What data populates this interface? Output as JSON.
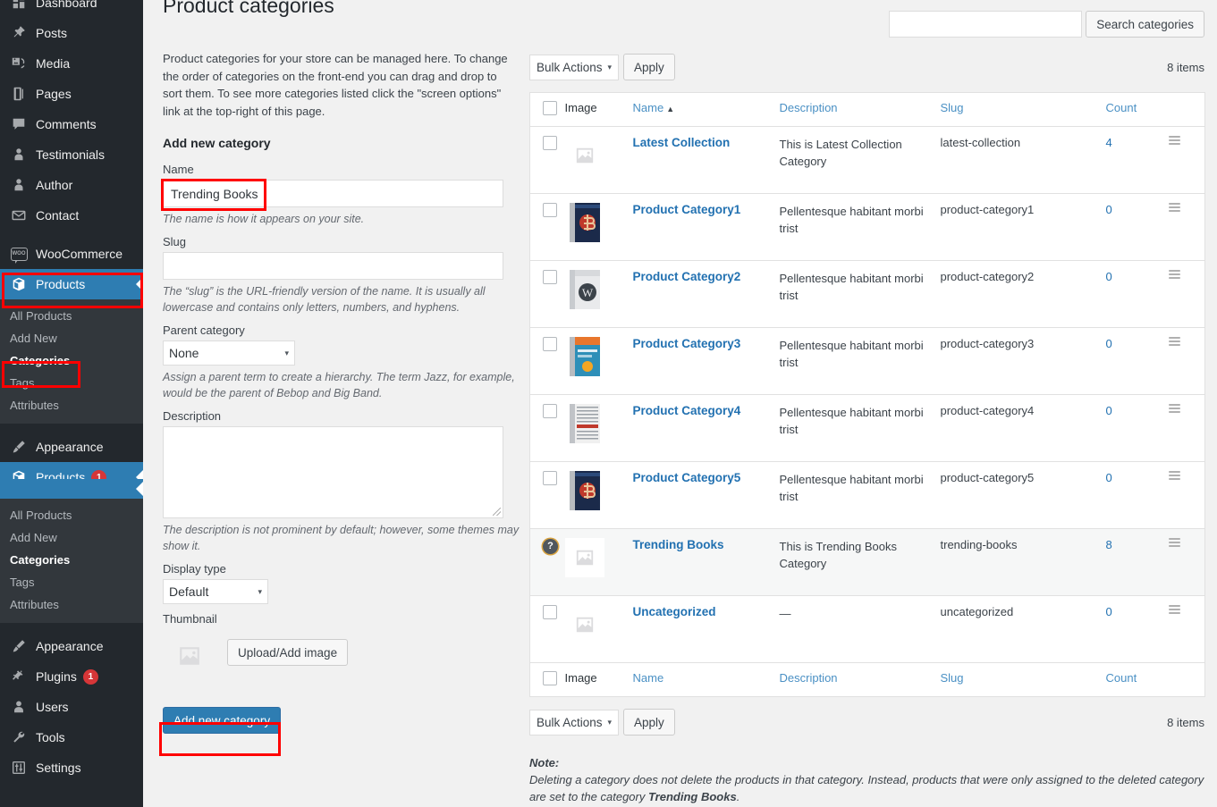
{
  "sidebar": {
    "top_items": [
      {
        "label": "Dashboard",
        "icon": "dashboard-icon"
      },
      {
        "label": "Posts",
        "icon": "pin-icon"
      },
      {
        "label": "Media",
        "icon": "media-icon"
      },
      {
        "label": "Pages",
        "icon": "pages-icon"
      },
      {
        "label": "Comments",
        "icon": "comment-icon"
      },
      {
        "label": "Testimonials",
        "icon": "person-icon"
      },
      {
        "label": "Author",
        "icon": "person-icon"
      },
      {
        "label": "Contact",
        "icon": "envelope-icon"
      }
    ],
    "woocommerce": {
      "label": "WooCommerce",
      "icon": "woo-icon",
      "mark": "WOO"
    },
    "products": {
      "label": "Products",
      "icon": "box-icon"
    },
    "products_submenu": [
      {
        "label": "All Products",
        "current": false
      },
      {
        "label": "Add New",
        "current": false
      },
      {
        "label": "Categories",
        "current": true
      },
      {
        "label": "Tags",
        "current": false
      },
      {
        "label": "Attributes",
        "current": false
      }
    ],
    "appearance": {
      "label": "Appearance",
      "icon": "brush-icon"
    },
    "bottom_items": [
      {
        "label": "Appearance",
        "icon": "brush-icon",
        "badge": ""
      },
      {
        "label": "Plugins",
        "icon": "plug-icon",
        "badge": "1"
      },
      {
        "label": "Users",
        "icon": "user-icon",
        "badge": ""
      },
      {
        "label": "Tools",
        "icon": "wrench-icon",
        "badge": ""
      },
      {
        "label": "Settings",
        "icon": "sliders-icon",
        "badge": ""
      }
    ]
  },
  "page": {
    "title": "Product categories",
    "intro": "Product categories for your store can be managed here. To change the order of categories on the front-end you can drag and drop to sort them. To see more categories listed click the \"screen options\" link at the top-right of this page."
  },
  "form": {
    "heading": "Add new category",
    "name_label": "Name",
    "name_value": "Trending Books",
    "name_desc": "The name is how it appears on your site.",
    "slug_label": "Slug",
    "slug_value": "",
    "slug_desc": "The “slug” is the URL-friendly version of the name. It is usually all lowercase and contains only letters, numbers, and hyphens.",
    "parent_label": "Parent category",
    "parent_value": "None",
    "parent_desc": "Assign a parent term to create a hierarchy. The term Jazz, for example, would be the parent of Bebop and Big Band.",
    "description_label": "Description",
    "description_value": "",
    "description_desc": "The description is not prominent by default; however, some themes may show it.",
    "display_type_label": "Display type",
    "display_type_value": "Default",
    "thumbnail_label": "Thumbnail",
    "upload_button": "Upload/Add image",
    "submit_button": "Add new category",
    "caret": "▾"
  },
  "toolbar": {
    "search_value": "",
    "search_button": "Search categories",
    "bulk_actions_label": "Bulk Actions",
    "apply_label": "Apply",
    "items_count": "8 items",
    "caret": "▾"
  },
  "table": {
    "columns": {
      "image": "Image",
      "name": "Name",
      "description": "Description",
      "slug": "Slug",
      "count": "Count"
    },
    "sort_arrow": "▲",
    "rows": [
      {
        "name": "Latest Collection",
        "description": "This is Latest Collection Category",
        "slug": "latest-collection",
        "count": "4",
        "thumb": "placeholder",
        "selector": "checkbox"
      },
      {
        "name": "Product Category1",
        "description": "Pellentesque habitant morbi trist",
        "slug": "product-category1",
        "count": "0",
        "thumb": "book-red",
        "selector": "checkbox"
      },
      {
        "name": "Product Category2",
        "description": "Pellentesque habitant morbi trist",
        "slug": "product-category2",
        "count": "0",
        "thumb": "book-wp",
        "selector": "checkbox"
      },
      {
        "name": "Product Category3",
        "description": "Pellentesque habitant morbi trist",
        "slug": "product-category3",
        "count": "0",
        "thumb": "book-blue",
        "selector": "checkbox"
      },
      {
        "name": "Product Category4",
        "description": "Pellentesque habitant morbi trist",
        "slug": "product-category4",
        "count": "0",
        "thumb": "book-gray",
        "selector": "checkbox"
      },
      {
        "name": "Product Category5",
        "description": "Pellentesque habitant morbi trist",
        "slug": "product-category5",
        "count": "0",
        "thumb": "book-red",
        "selector": "checkbox"
      },
      {
        "name": "Trending Books",
        "description": "This is Trending Books Category",
        "slug": "trending-books",
        "count": "8",
        "thumb": "placeholder",
        "selector": "help"
      },
      {
        "name": "Uncategorized",
        "description": "—",
        "slug": "uncategorized",
        "count": "0",
        "thumb": "placeholder",
        "selector": "checkbox"
      }
    ]
  },
  "note": {
    "title": "Note:",
    "text_before": "Deleting a category does not delete the products in that category. Instead, products that were only assigned to the deleted category are set to the category ",
    "bold_term": "Trending Books",
    "text_after": "."
  },
  "colors": {
    "sidebar_bg": "#23282d",
    "submenu_bg": "#32373c",
    "accent_blue": "#2e7db2",
    "link_blue": "#2271b1",
    "annotation_red": "#ff0000",
    "badge_red": "#d63638"
  }
}
